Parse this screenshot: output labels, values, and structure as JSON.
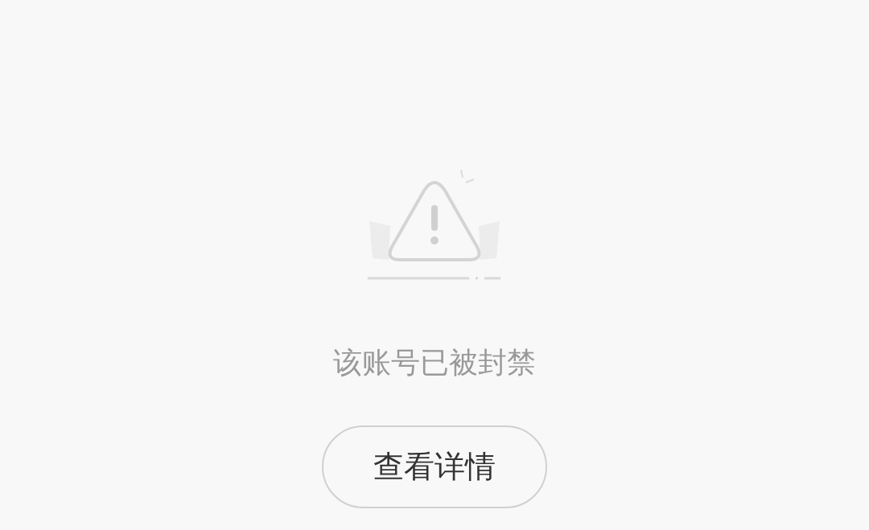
{
  "message": "该账号已被封禁",
  "button": {
    "label": "查看详情"
  }
}
